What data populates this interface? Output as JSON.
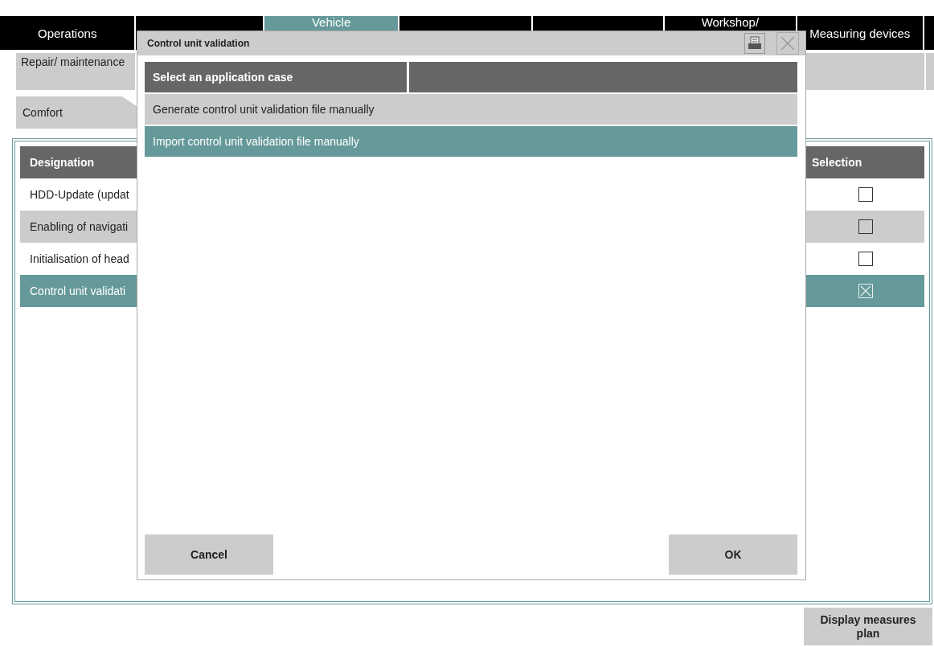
{
  "nav_tabs": [
    {
      "label": "Operations",
      "selected": false,
      "wrapped": false
    },
    {
      "selected": false
    },
    {
      "label": "Vehicle",
      "selected": true,
      "wrapped": true
    },
    {
      "selected": false
    },
    {
      "selected": false
    },
    {
      "label": "Workshop/",
      "selected": false,
      "wrapped": true
    },
    {
      "label": "Measuring devices",
      "selected": false,
      "wrapped": false
    },
    {
      "selected": false
    }
  ],
  "sub_tab": {
    "label": "Repair/ maintenance"
  },
  "section_tab": {
    "label": "Comfort"
  },
  "table": {
    "columns": [
      "Designation",
      "Selection"
    ],
    "rows": [
      {
        "designation": "HDD-Update (updat",
        "checked": false,
        "selected": false
      },
      {
        "designation": "Enabling of navigati",
        "checked": false,
        "selected": false
      },
      {
        "designation": "Initialisation of head",
        "checked": false,
        "selected": false
      },
      {
        "designation": "Control unit validati",
        "checked": true,
        "selected": true
      }
    ]
  },
  "display_button": "Display measures plan",
  "dialog": {
    "title": "Control unit validation",
    "header": "Select an application case",
    "options": [
      {
        "label": "Generate control unit validation file manually",
        "selected": false
      },
      {
        "label": "Import control unit validation file manually",
        "selected": true
      }
    ],
    "buttons": [
      "Cancel",
      "OK"
    ]
  }
}
